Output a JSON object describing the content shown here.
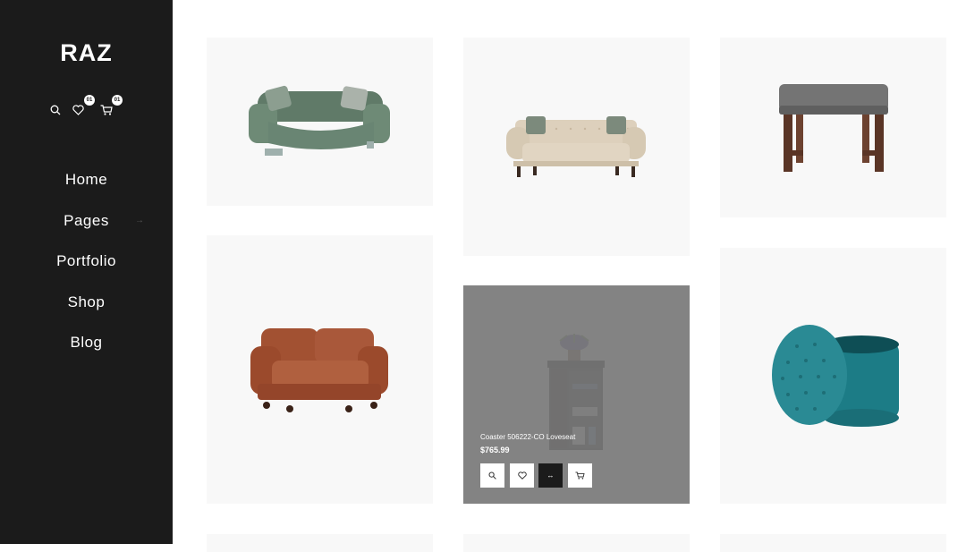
{
  "brand": {
    "logo": "RAZ"
  },
  "header_icons": {
    "search": "search-icon",
    "wishlist": {
      "icon": "heart-icon",
      "count": "01"
    },
    "cart": {
      "icon": "cart-icon",
      "count": "01"
    }
  },
  "nav": {
    "items": [
      {
        "label": "Home"
      },
      {
        "label": "Pages",
        "arrow": "→"
      },
      {
        "label": "Portfolio"
      },
      {
        "label": "Shop"
      },
      {
        "label": "Blog"
      }
    ]
  },
  "products": {
    "hover_card": {
      "name": "Coaster 506222-CO Loveseat",
      "price": "$765.99",
      "actions": [
        "quick-view-icon",
        "heart-icon",
        "compare-icon",
        "add-to-cart-icon"
      ],
      "compare_glyph": "↔"
    }
  },
  "colors": {
    "sidebar": "#1b1b1b",
    "card": "#f8f8f8",
    "overlay": "#7a7a7a"
  }
}
